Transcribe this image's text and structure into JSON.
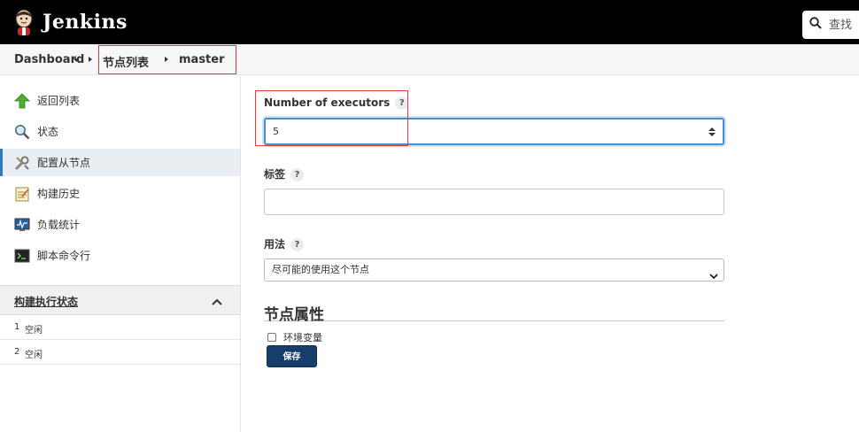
{
  "header": {
    "app_name": "Jenkins",
    "search_placeholder": "查找"
  },
  "breadcrumbs": {
    "items": [
      "Dashboard",
      "节点列表",
      "master"
    ]
  },
  "sidebar": {
    "tasks": [
      {
        "label": "返回列表",
        "icon": "up-arrow-icon"
      },
      {
        "label": "状态",
        "icon": "magnifier-icon"
      },
      {
        "label": "配置从节点",
        "icon": "wrench-icon"
      },
      {
        "label": "构建历史",
        "icon": "notepad-icon"
      },
      {
        "label": "负载统计",
        "icon": "monitor-icon"
      },
      {
        "label": "脚本命令行",
        "icon": "terminal-icon"
      }
    ],
    "executor_panel": {
      "title": "构建执行状态",
      "rows": [
        {
          "number": "1",
          "status": "空闲"
        },
        {
          "number": "2",
          "status": "空闲"
        }
      ]
    }
  },
  "form": {
    "executors": {
      "label": "Number of executors",
      "value": "5"
    },
    "labels": {
      "label": "标签",
      "value": ""
    },
    "usage": {
      "label": "用法",
      "selected": "尽可能的使用这个节点"
    },
    "node_properties": {
      "title": "节点属性",
      "env_vars_label": "环境变量",
      "env_vars_checked": false
    },
    "save_label": "保存",
    "help_glyph": "?"
  },
  "colors": {
    "header_bg": "#000000",
    "save_button": "#173d6a",
    "focus_border": "#4a90c8",
    "annotation_red": "#e53935"
  }
}
